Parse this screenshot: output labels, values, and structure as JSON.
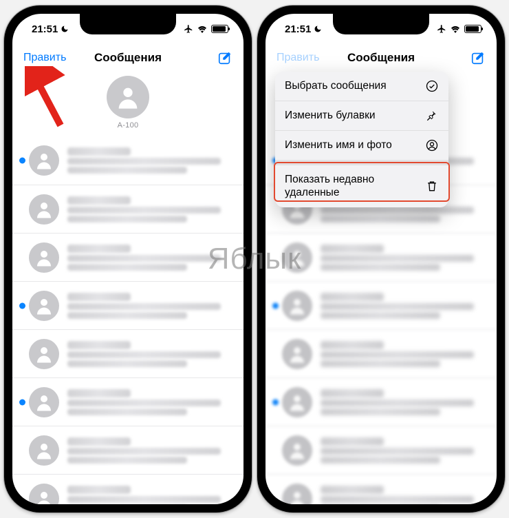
{
  "status": {
    "time": "21:51"
  },
  "nav": {
    "edit": "Править",
    "title": "Сообщения"
  },
  "pinned": {
    "name": "A-100"
  },
  "menu": {
    "select": "Выбрать сообщения",
    "pins": "Изменить булавки",
    "nameAndPhoto": "Изменить имя и фото",
    "recentlyDeleted": "Показать недавно удаленные"
  },
  "watermark": "Яблык"
}
